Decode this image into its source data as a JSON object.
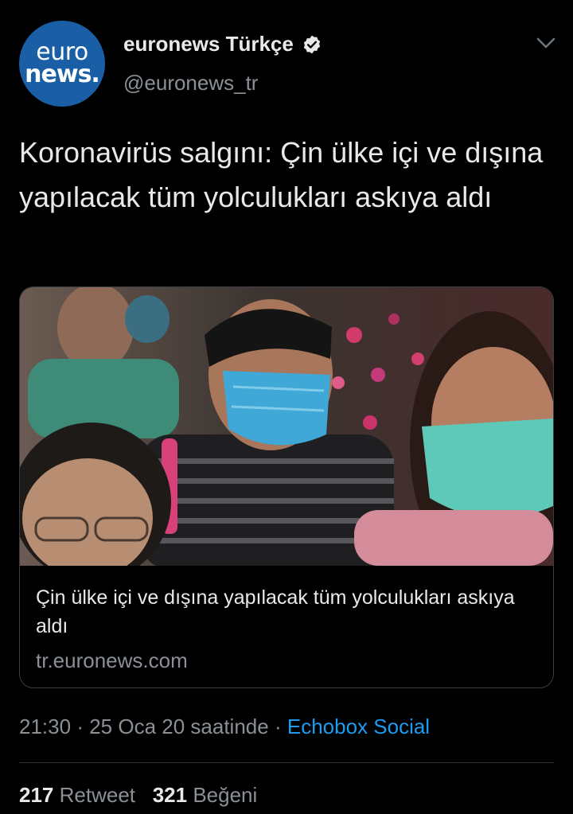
{
  "account": {
    "avatar_line1": "euro",
    "avatar_line2": "news.",
    "display_name": "euronews Türkçe",
    "handle": "@euronews_tr",
    "verified_icon": "verified-badge-icon",
    "menu_icon": "chevron-down-icon"
  },
  "tweet": {
    "text": "Koronavirüs salgını: Çin ülke içi ve dışına yapılacak tüm yolculukları askıya aldı"
  },
  "card": {
    "title": "Çin ülke içi ve dışına yapılacak tüm yolculukları askıya aldı",
    "domain": "tr.euronews.com"
  },
  "meta": {
    "time": "21:30",
    "sep1": "·",
    "date": "25 Oca 20 saatinde",
    "sep2": "·",
    "source": "Echobox Social"
  },
  "stats": {
    "retweet_count": "217",
    "retweet_label": "Retweet",
    "like_count": "321",
    "like_label": "Beğeni"
  },
  "colors": {
    "background": "#000000",
    "link": "#1d9bf0",
    "avatar": "#1a5fa6"
  }
}
